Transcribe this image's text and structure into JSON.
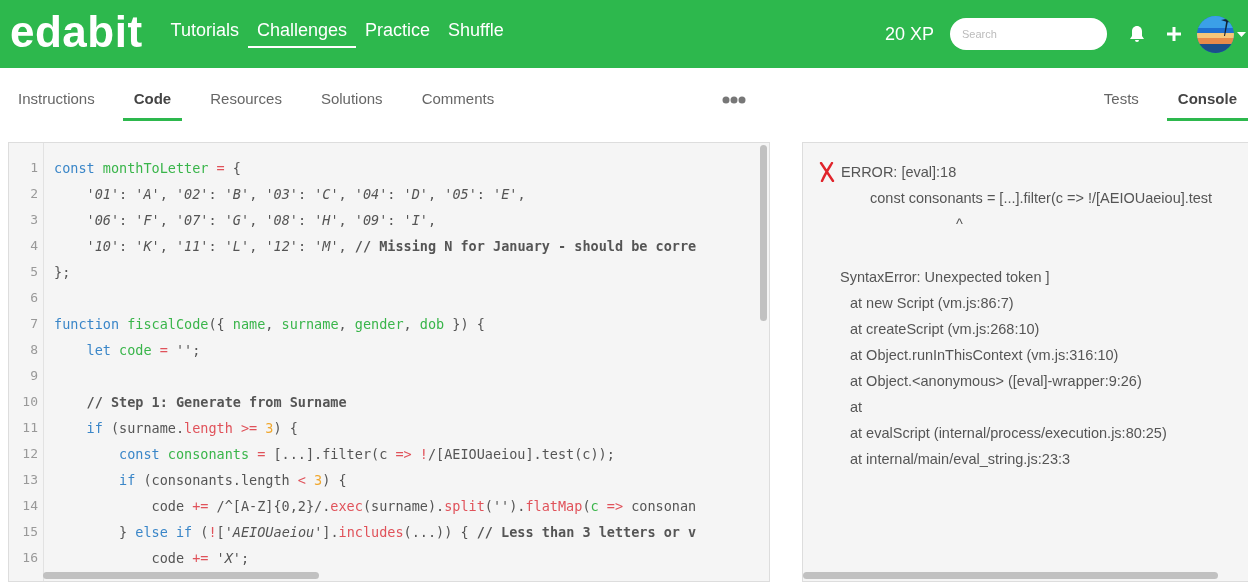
{
  "header": {
    "logo": "edabit",
    "nav": [
      {
        "label": "Tutorials",
        "selected": false
      },
      {
        "label": "Challenges",
        "selected": true
      },
      {
        "label": "Practice",
        "selected": false
      },
      {
        "label": "Shuffle",
        "selected": false
      }
    ],
    "xp": "20 XP",
    "search": {
      "placeholder": "Search"
    }
  },
  "left_tabs": [
    {
      "label": "Instructions",
      "selected": false
    },
    {
      "label": "Code",
      "selected": true
    },
    {
      "label": "Resources",
      "selected": false
    },
    {
      "label": "Solutions",
      "selected": false
    },
    {
      "label": "Comments",
      "selected": false
    }
  ],
  "right_tabs": [
    {
      "label": "Tests",
      "selected": false
    },
    {
      "label": "Console",
      "selected": true
    }
  ],
  "editor": {
    "lines": [
      {
        "number": "1",
        "tokens": [
          {
            "kind": "keyword",
            "text": "const "
          },
          {
            "kind": "def",
            "text": "monthToLetter "
          },
          {
            "kind": "operator",
            "text": "="
          },
          {
            "kind": "plain",
            "text": " {"
          }
        ]
      },
      {
        "number": "2",
        "tokens": [
          {
            "kind": "string",
            "text": "    '01'"
          },
          {
            "kind": "plain",
            "text": ": "
          },
          {
            "kind": "string",
            "text": "'A'"
          },
          {
            "kind": "plain",
            "text": ", "
          },
          {
            "kind": "string",
            "text": "'02'"
          },
          {
            "kind": "plain",
            "text": ": "
          },
          {
            "kind": "string",
            "text": "'B'"
          },
          {
            "kind": "plain",
            "text": ", "
          },
          {
            "kind": "string",
            "text": "'03'"
          },
          {
            "kind": "plain",
            "text": ": "
          },
          {
            "kind": "string",
            "text": "'C'"
          },
          {
            "kind": "plain",
            "text": ", "
          },
          {
            "kind": "string",
            "text": "'04'"
          },
          {
            "kind": "plain",
            "text": ": "
          },
          {
            "kind": "string",
            "text": "'D'"
          },
          {
            "kind": "plain",
            "text": ", "
          },
          {
            "kind": "string",
            "text": "'05'"
          },
          {
            "kind": "plain",
            "text": ": "
          },
          {
            "kind": "string",
            "text": "'E'"
          },
          {
            "kind": "plain",
            "text": ","
          }
        ]
      },
      {
        "number": "3",
        "tokens": [
          {
            "kind": "string",
            "text": "    '06'"
          },
          {
            "kind": "plain",
            "text": ": "
          },
          {
            "kind": "string",
            "text": "'F'"
          },
          {
            "kind": "plain",
            "text": ", "
          },
          {
            "kind": "string",
            "text": "'07'"
          },
          {
            "kind": "plain",
            "text": ": "
          },
          {
            "kind": "string",
            "text": "'G'"
          },
          {
            "kind": "plain",
            "text": ", "
          },
          {
            "kind": "string",
            "text": "'08'"
          },
          {
            "kind": "plain",
            "text": ": "
          },
          {
            "kind": "string",
            "text": "'H'"
          },
          {
            "kind": "plain",
            "text": ", "
          },
          {
            "kind": "string",
            "text": "'09'"
          },
          {
            "kind": "plain",
            "text": ": "
          },
          {
            "kind": "string",
            "text": "'I'"
          },
          {
            "kind": "plain",
            "text": ","
          }
        ]
      },
      {
        "number": "4",
        "tokens": [
          {
            "kind": "string",
            "text": "    '10'"
          },
          {
            "kind": "plain",
            "text": ": "
          },
          {
            "kind": "string",
            "text": "'K'"
          },
          {
            "kind": "plain",
            "text": ", "
          },
          {
            "kind": "string",
            "text": "'11'"
          },
          {
            "kind": "plain",
            "text": ": "
          },
          {
            "kind": "string",
            "text": "'L'"
          },
          {
            "kind": "plain",
            "text": ", "
          },
          {
            "kind": "string",
            "text": "'12'"
          },
          {
            "kind": "plain",
            "text": ": "
          },
          {
            "kind": "string",
            "text": "'M'"
          },
          {
            "kind": "plain",
            "text": ", "
          },
          {
            "kind": "comment",
            "text": "// Missing N for January - should be corre"
          }
        ]
      },
      {
        "number": "5",
        "tokens": [
          {
            "kind": "plain",
            "text": "};"
          }
        ]
      },
      {
        "number": "6"
      },
      {
        "number": "7",
        "tokens": [
          {
            "kind": "keyword",
            "text": "function "
          },
          {
            "kind": "def",
            "text": "fiscalCode"
          },
          {
            "kind": "plain",
            "text": "({ "
          },
          {
            "kind": "def",
            "text": "name"
          },
          {
            "kind": "plain",
            "text": ", "
          },
          {
            "kind": "def",
            "text": "surname"
          },
          {
            "kind": "plain",
            "text": ", "
          },
          {
            "kind": "def",
            "text": "gender"
          },
          {
            "kind": "plain",
            "text": ", "
          },
          {
            "kind": "def",
            "text": "dob"
          },
          {
            "kind": "plain",
            "text": " }) {"
          }
        ]
      },
      {
        "number": "8",
        "tokens": [
          {
            "kind": "keyword",
            "text": "    let "
          },
          {
            "kind": "def",
            "text": "code "
          },
          {
            "kind": "operator",
            "text": "= "
          },
          {
            "kind": "string",
            "text": "''"
          },
          {
            "kind": "plain",
            "text": ";"
          }
        ]
      },
      {
        "number": "9"
      },
      {
        "number": "10",
        "tokens": [
          {
            "kind": "comment",
            "text": "    // Step 1: Generate from Surname"
          }
        ]
      },
      {
        "number": "11",
        "tokens": [
          {
            "kind": "keyword",
            "text": "    if"
          },
          {
            "kind": "plain",
            "text": " (surname."
          },
          {
            "kind": "property",
            "text": "length "
          },
          {
            "kind": "operator",
            "text": ">= "
          },
          {
            "kind": "number",
            "text": "3"
          },
          {
            "kind": "plain",
            "text": ") {"
          }
        ]
      },
      {
        "number": "12",
        "tokens": [
          {
            "kind": "keyword",
            "text": "        const "
          },
          {
            "kind": "def",
            "text": "consonants "
          },
          {
            "kind": "operator",
            "text": "="
          },
          {
            "kind": "plain",
            "text": " [...].filter(c "
          },
          {
            "kind": "operator",
            "text": "=> !"
          },
          {
            "kind": "plain",
            "text": "/[AEIOUaeiou].test(c));"
          }
        ]
      },
      {
        "number": "13",
        "tokens": [
          {
            "kind": "keyword",
            "text": "        if"
          },
          {
            "kind": "plain",
            "text": " (consonants.length "
          },
          {
            "kind": "operator",
            "text": "< "
          },
          {
            "kind": "number",
            "text": "3"
          },
          {
            "kind": "plain",
            "text": ") {"
          }
        ]
      },
      {
        "number": "14",
        "tokens": [
          {
            "kind": "plain",
            "text": "            code "
          },
          {
            "kind": "operator",
            "text": "+="
          },
          {
            "kind": "plain",
            "text": " /^[A-Z]{0,2}/."
          },
          {
            "kind": "property",
            "text": "exec"
          },
          {
            "kind": "plain",
            "text": "(surname)."
          },
          {
            "kind": "property",
            "text": "split"
          },
          {
            "kind": "plain",
            "text": "("
          },
          {
            "kind": "string",
            "text": "''"
          },
          {
            "kind": "plain",
            "text": ")."
          },
          {
            "kind": "property",
            "text": "flatMap"
          },
          {
            "kind": "plain",
            "text": "("
          },
          {
            "kind": "def",
            "text": "c "
          },
          {
            "kind": "operator",
            "text": "=>"
          },
          {
            "kind": "plain",
            "text": " consonan"
          }
        ]
      },
      {
        "number": "15",
        "tokens": [
          {
            "kind": "plain",
            "text": "        } "
          },
          {
            "kind": "keyword",
            "text": "else if"
          },
          {
            "kind": "plain",
            "text": " ("
          },
          {
            "kind": "operator",
            "text": "!"
          },
          {
            "kind": "plain",
            "text": "["
          },
          {
            "kind": "string",
            "text": "'AEIOUaeiou'"
          },
          {
            "kind": "plain",
            "text": "]."
          },
          {
            "kind": "property",
            "text": "includes"
          },
          {
            "kind": "plain",
            "text": "(...)) { "
          },
          {
            "kind": "comment",
            "text": "// Less than 3 letters or v"
          }
        ]
      },
      {
        "number": "16",
        "tokens": [
          {
            "kind": "plain",
            "text": "            code "
          },
          {
            "kind": "operator",
            "text": "+= "
          },
          {
            "kind": "string",
            "text": "'X'"
          },
          {
            "kind": "plain",
            "text": ";"
          }
        ]
      }
    ]
  },
  "console": {
    "lines": [
      {
        "kind": "error",
        "text": "ERROR: [eval]:18"
      },
      {
        "kind": "code",
        "text": "const consonants = [...].filter(c => !/[AEIOUaeiou].test"
      },
      {
        "kind": "caret",
        "text": "^"
      },
      {
        "kind": "message",
        "text": "SyntaxError: Unexpected token ]"
      },
      {
        "kind": "trace",
        "text": "at new Script (vm.js:86:7)"
      },
      {
        "kind": "trace",
        "text": "at createScript (vm.js:268:10)"
      },
      {
        "kind": "trace",
        "text": "at Object.runInThisContext (vm.js:316:10)"
      },
      {
        "kind": "trace",
        "text": "at Object.<anonymous> ([eval]-wrapper:9:26)"
      },
      {
        "kind": "trace",
        "text": "at"
      },
      {
        "kind": "trace",
        "text": "at evalScript (internal/process/execution.js:80:25)"
      },
      {
        "kind": "trace",
        "text": "at internal/main/eval_string.js:23:3"
      }
    ]
  }
}
